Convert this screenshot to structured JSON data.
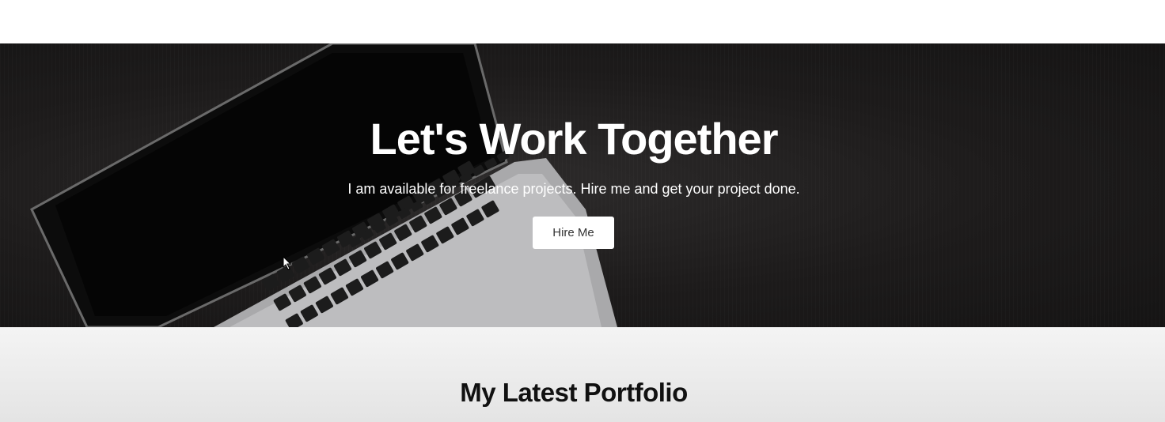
{
  "hero": {
    "title": "Let's Work Together",
    "subtitle": "I am available for freelance projects. Hire me and get your project done.",
    "cta_label": "Hire Me",
    "background_image": "laptop-keyboard-photo"
  },
  "portfolio": {
    "title": "My Latest Portfolio"
  },
  "colors": {
    "hero_bg": "#1d1b1b",
    "hero_text": "#ffffff",
    "button_bg": "#ffffff",
    "button_text": "#333333",
    "section_bg": "#efefef"
  }
}
